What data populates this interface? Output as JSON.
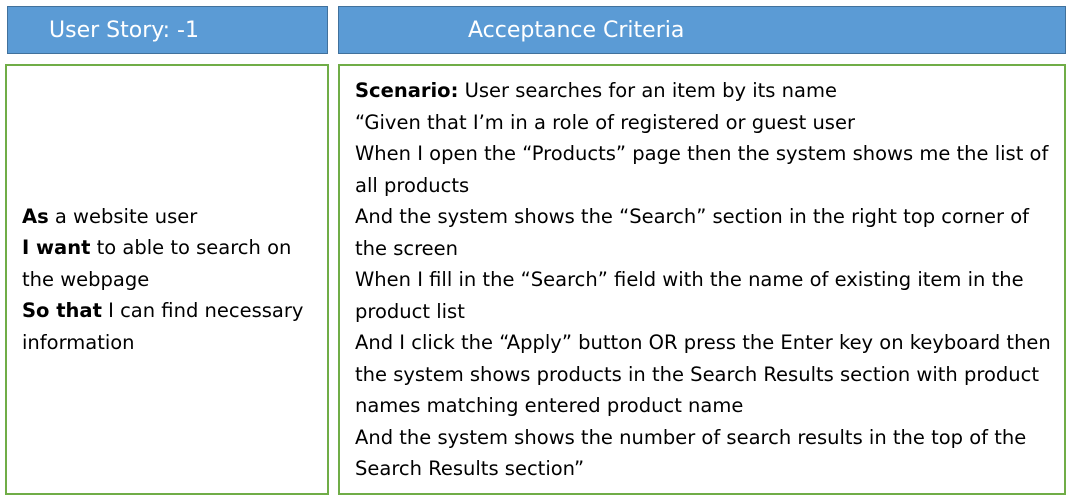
{
  "left_header": "User Story: -1",
  "right_header": "Acceptance Criteria",
  "user_story": {
    "as_keyword": "As",
    "as_text": " a website user",
    "want_keyword": "I want",
    "want_text": " to able to search on the webpage",
    "so_keyword": "So that",
    "so_text": " I can find necessary information"
  },
  "criteria": {
    "scenario_keyword": "Scenario:",
    "scenario_text": " User searches for an item by its name",
    "given": "“Given that I’m in a role of registered or guest user",
    "when_open": "When I open the “Products” page then the system shows me the list of all products",
    "and_search_section": "And the system shows the “Search” section in the right top corner of the screen",
    "when_fill": "When I fill in the “Search” field with the name of existing item in the product list",
    "and_click": "And I click the “Apply” button OR press the Enter key on keyboard then the system shows products in the Search Results section with product names matching entered product name",
    "and_number": "And the system shows the number of search results in the top of the Search Results section”"
  },
  "colors": {
    "header_fill": "#5b9bd5",
    "header_border": "#41719c",
    "panel_border": "#70ad47"
  }
}
